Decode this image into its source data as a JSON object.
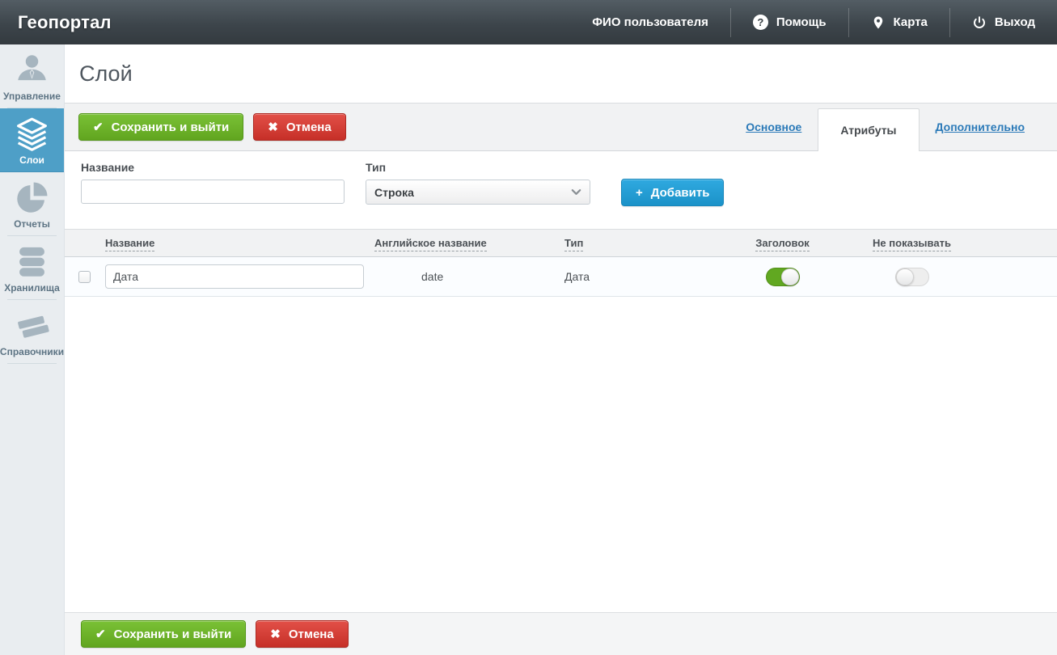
{
  "header": {
    "brand": "Геопортал",
    "user": "ФИО пользователя",
    "menu": [
      {
        "label": "Помощь",
        "icon": "help-icon"
      },
      {
        "label": "Карта",
        "icon": "map-pin-icon"
      },
      {
        "label": "Выход",
        "icon": "power-icon"
      }
    ]
  },
  "sidebar": {
    "items": [
      {
        "label": "Управление",
        "icon": "user-icon",
        "active": false
      },
      {
        "label": "Слои",
        "icon": "layers-icon",
        "active": true
      },
      {
        "label": "Отчеты",
        "icon": "pie-chart-icon",
        "active": false
      },
      {
        "label": "Хранилища",
        "icon": "database-icon",
        "active": false
      },
      {
        "label": "Справочники",
        "icon": "books-icon",
        "active": false
      }
    ]
  },
  "page": {
    "title": "Слой"
  },
  "toolbar": {
    "save_label": "Сохранить и выйти",
    "cancel_label": "Отмена"
  },
  "tabs": [
    {
      "label": "Основное",
      "active": false
    },
    {
      "label": "Атрибуты",
      "active": true
    },
    {
      "label": "Дополнительно",
      "active": false
    }
  ],
  "form": {
    "name_label": "Название",
    "name_value": "",
    "type_label": "Тип",
    "type_value": "Строка",
    "add_label": "Добавить"
  },
  "table": {
    "columns": [
      "Название",
      "Английское название",
      "Тип",
      "Заголовок",
      "Не показывать"
    ],
    "rows": [
      {
        "name": "Дата",
        "en_name": "date",
        "type": "Дата",
        "header_on": true,
        "hide_on": false
      }
    ]
  },
  "colors": {
    "sidebar_active_blue": "#4e9fc7",
    "link_blue": "#2b7ab8",
    "button_green": "#61a51f",
    "button_red": "#c62f28",
    "button_blue": "#1b92c8",
    "toggle_on_green": "#61a821",
    "header_dark": "#3d454b"
  }
}
